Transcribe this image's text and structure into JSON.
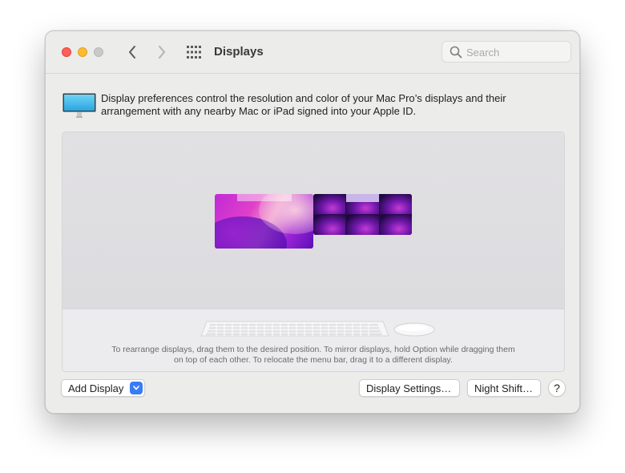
{
  "toolbar": {
    "title": "Displays",
    "search_placeholder": "Search",
    "icons": {
      "back": "chevron-left-icon",
      "forward": "chevron-right-icon",
      "grid": "grid-icon",
      "search": "search-icon"
    }
  },
  "description": {
    "text": "Display preferences control the resolution and color of your Mac Pro’s displays and their arrangement with any nearby Mac or iPad signed into your Apple ID."
  },
  "arrangement": {
    "hint": "To rearrange displays, drag them to the desired position. To mirror displays, hold Option while dragging them on top of each other. To relocate the menu bar, drag it to a different display."
  },
  "buttons": {
    "add_display": "Add Display",
    "display_settings": "Display Settings…",
    "night_shift": "Night Shift…",
    "help": "?"
  },
  "colors": {
    "close": "#fe5f57",
    "minimize": "#febc2e",
    "zoom": "#c9c9c9",
    "accent": "#3a7bf6"
  }
}
